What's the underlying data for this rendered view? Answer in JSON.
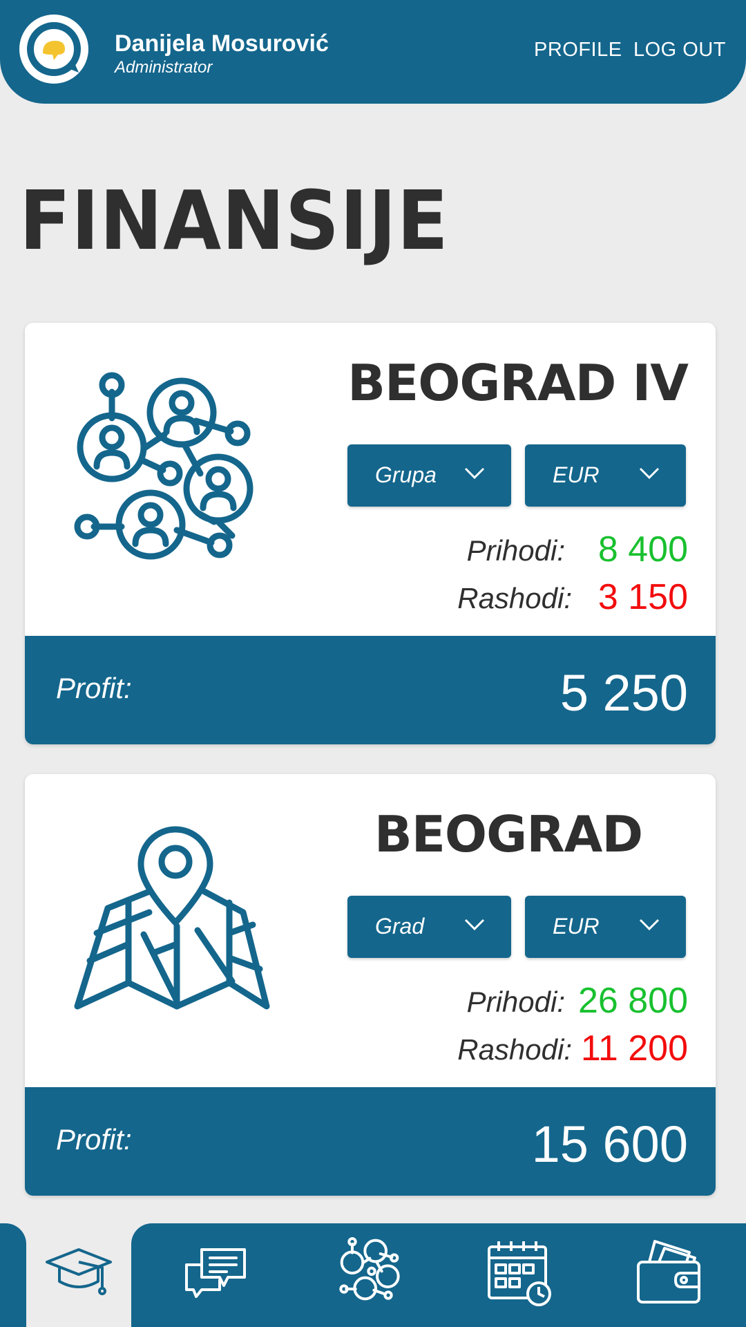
{
  "header": {
    "user_name": "Danijela Mosurović",
    "user_role": "Administrator",
    "profile_link": "PROFILE",
    "logout_link": "LOG OUT"
  },
  "page": {
    "title": "FINANSIJE"
  },
  "cards": [
    {
      "name": "BEOGRAD IV",
      "icon": "network-people-icon",
      "dropdown_type": "Grupa",
      "dropdown_currency": "EUR",
      "income_label": "Prihodi:",
      "income_value": "8 400",
      "expense_label": "Rashodi:",
      "expense_value": "3 150",
      "profit_label": "Profit:",
      "profit_value": "5 250"
    },
    {
      "name": "BEOGRAD",
      "icon": "map-pin-icon",
      "dropdown_type": "Grad",
      "dropdown_currency": "EUR",
      "income_label": "Prihodi:",
      "income_value": "26 800",
      "expense_label": "Rashodi:",
      "expense_value": "11 200",
      "profit_label": "Profit:",
      "profit_value": "15 600"
    }
  ],
  "bottom_nav": {
    "items": [
      "graduation-cap-icon",
      "chat-icon",
      "network-icon",
      "calendar-icon",
      "wallet-icon"
    ],
    "active": "graduation-cap-icon"
  },
  "colors": {
    "primary": "#14668c",
    "income": "#19c02f",
    "expense": "#f20d0d",
    "background": "#ececec"
  }
}
